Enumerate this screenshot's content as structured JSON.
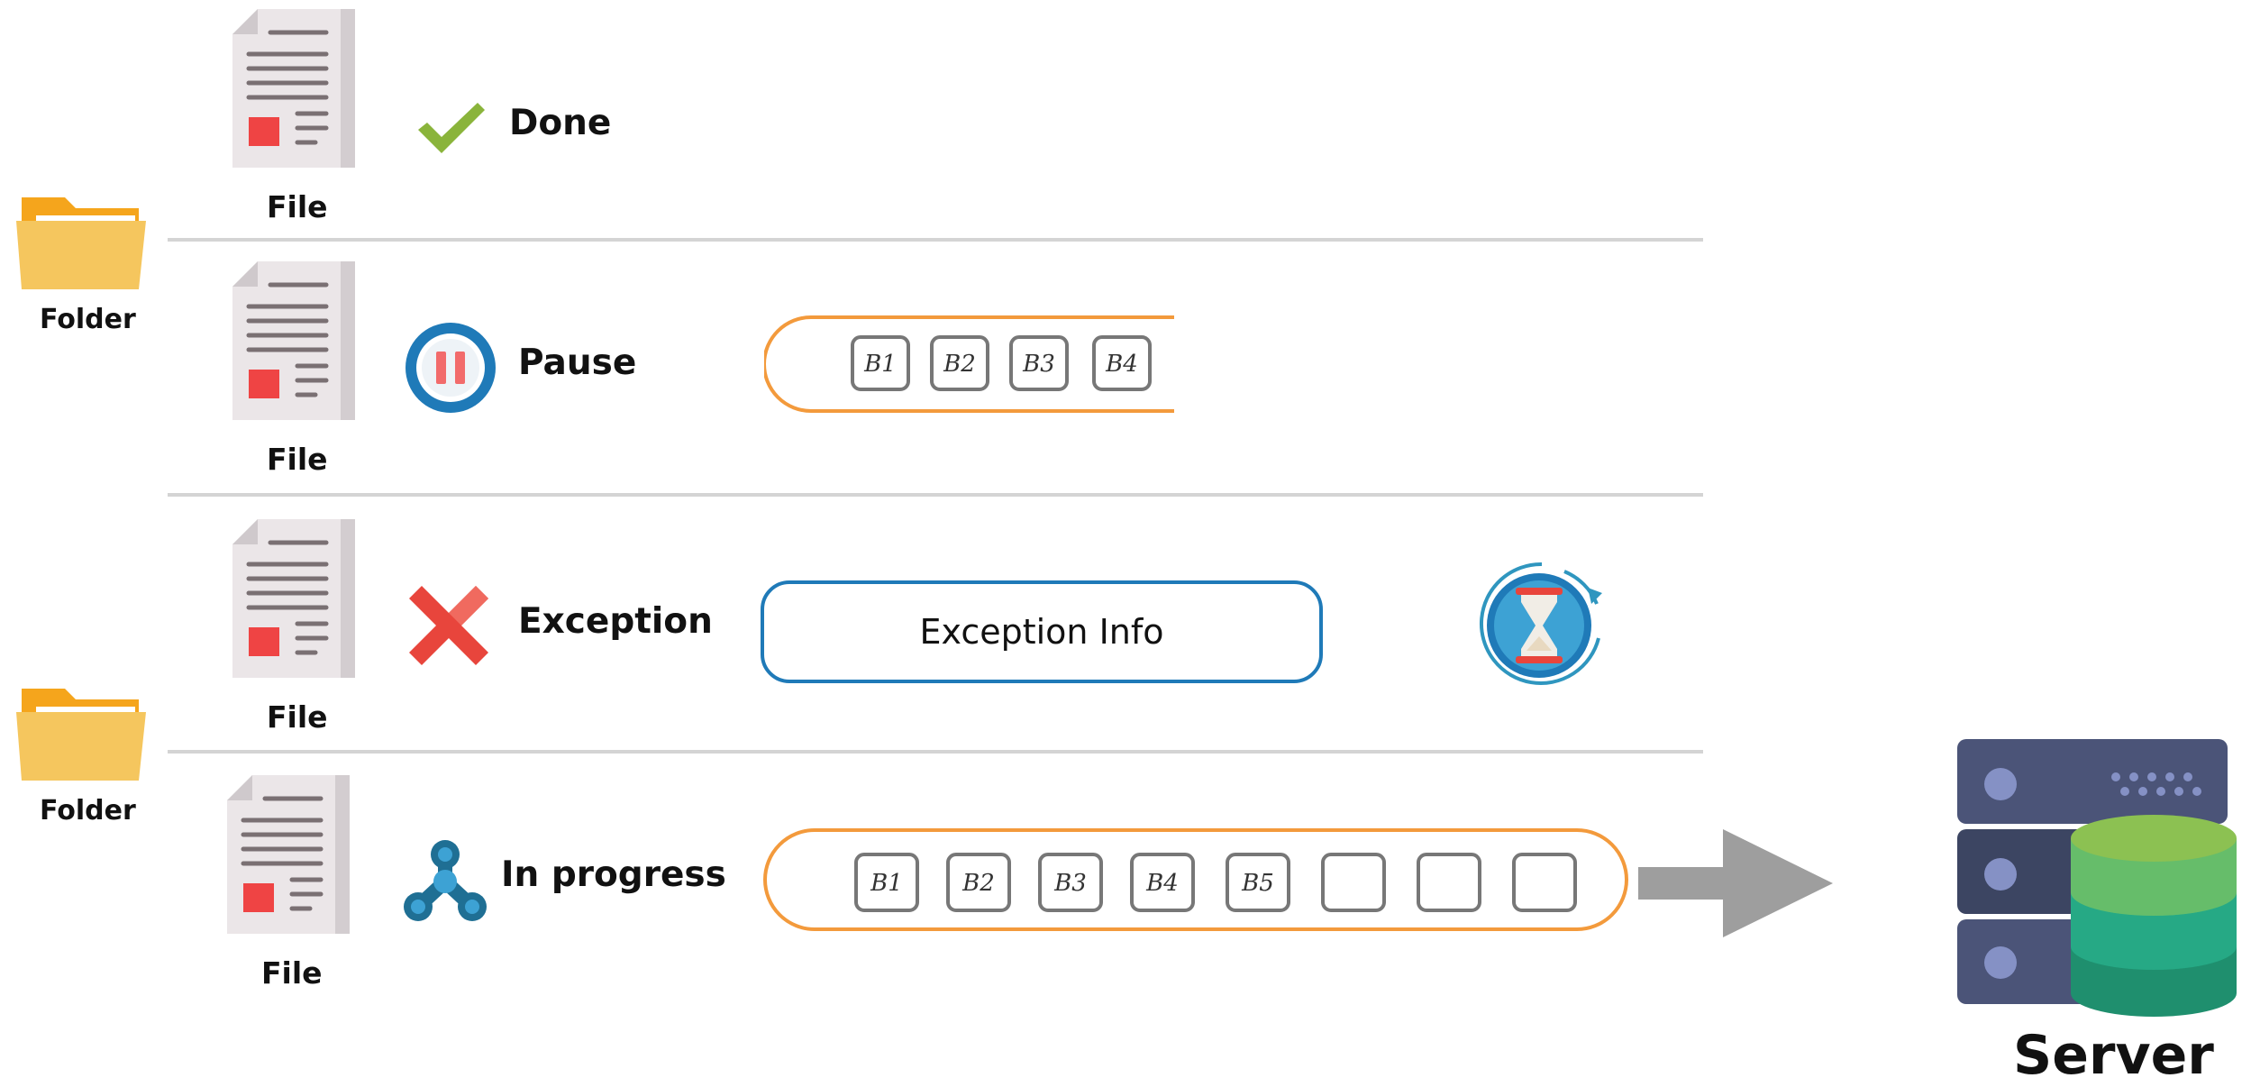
{
  "folders": [
    {
      "label": "Folder"
    },
    {
      "label": "Folder"
    }
  ],
  "rows": [
    {
      "file_label": "File",
      "status": "Done",
      "status_icon": "check-icon"
    },
    {
      "file_label": "File",
      "status": "Pause",
      "status_icon": "pause-icon",
      "blocks": [
        "B1",
        "B2",
        "B3",
        "B4"
      ]
    },
    {
      "file_label": "File",
      "status": "Exception",
      "status_icon": "cross-icon",
      "exception_info": "Exception Info",
      "retry_icon": "hourglass-retry-icon"
    },
    {
      "file_label": "File",
      "status": "In progress",
      "status_icon": "spinner-icon",
      "blocks": [
        "B1",
        "B2",
        "B3",
        "B4",
        "B5",
        "",
        "",
        ""
      ]
    }
  ],
  "server": {
    "label": "Server"
  },
  "colors": {
    "pipe_orange": "#f39a3c",
    "exception_blue": "#1f7ab8",
    "check_green": "#8ab43b",
    "cross_red": "#e8453c",
    "arrow_gray": "#9e9e9e"
  }
}
